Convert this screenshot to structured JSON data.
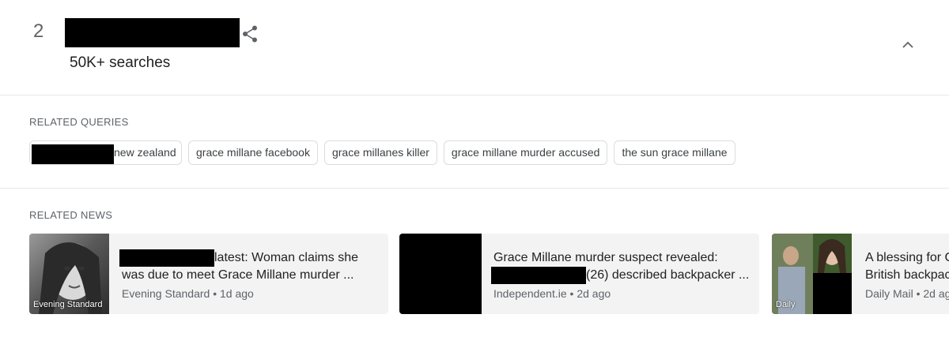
{
  "trend": {
    "rank": "2",
    "searches": "50K+ searches"
  },
  "related_queries": {
    "heading": "RELATED QUERIES",
    "chips": [
      "new zealand",
      "grace millane facebook",
      "grace millanes killer",
      "grace millane murder accused",
      "the sun grace millane"
    ]
  },
  "related_news": {
    "heading": "RELATED NEWS",
    "cards": [
      {
        "thumb_label": "Evening Standard",
        "headline_line1": "latest: Woman claims she",
        "headline_line2": "was due to meet Grace Millane murder ...",
        "meta": "Evening Standard • 1d ago"
      },
      {
        "thumb_label": "",
        "headline_line1": "Grace Millane murder suspect revealed:",
        "headline_line2": "(26) described backpacker ...",
        "meta": "Independent.ie • 2d ago"
      },
      {
        "thumb_label": "Daily",
        "headline_line1": "A blessing for C",
        "headline_line2": "British backpac",
        "meta": "Daily Mail • 2d ag"
      }
    ]
  },
  "icons": {
    "share": "share-icon",
    "collapse": "chevron-up-icon"
  }
}
